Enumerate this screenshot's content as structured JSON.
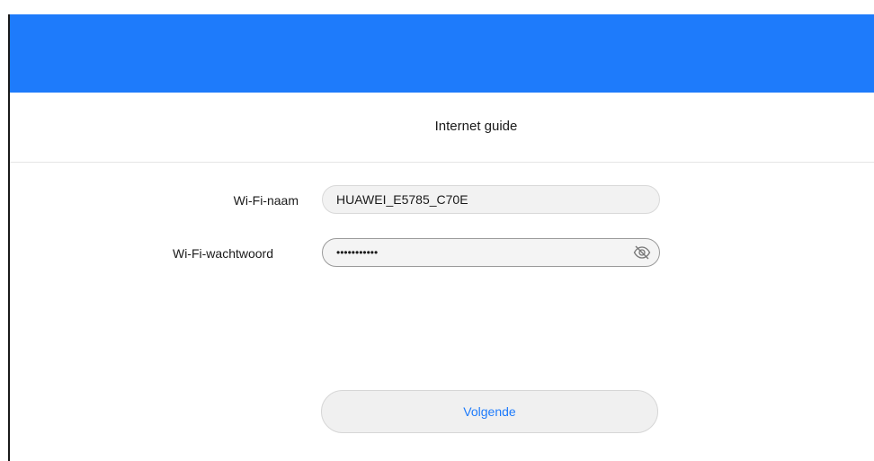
{
  "header": {
    "title": "Internet guide"
  },
  "form": {
    "wifi_name": {
      "label": "Wi-Fi-naam",
      "value": "HUAWEI_E5785_C70E"
    },
    "wifi_password": {
      "label": "Wi-Fi-wachtwoord",
      "value": "•••••••••••",
      "toggle_icon": "eye-slash-icon"
    }
  },
  "actions": {
    "next_label": "Volgende"
  },
  "colors": {
    "accent": "#1e7bfb",
    "field_background": "#f2f2f2",
    "text": "#1a1a1a"
  }
}
